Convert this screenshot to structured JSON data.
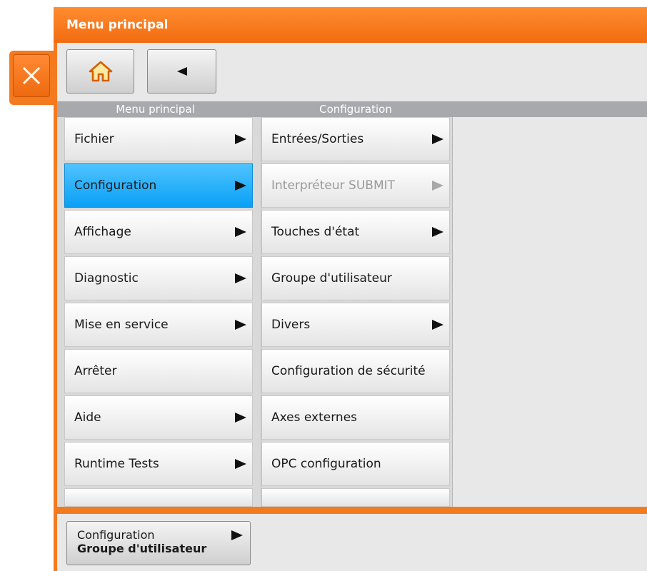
{
  "window": {
    "title": "Menu principal"
  },
  "toolbar": {
    "home_icon": "home-icon",
    "back_icon": "back-arrow-icon"
  },
  "columns": {
    "main_header": "Menu principal",
    "config_header": "Configuration"
  },
  "main_menu": [
    {
      "label": "Fichier",
      "has_submenu": true
    },
    {
      "label": "Configuration",
      "has_submenu": true,
      "active": true
    },
    {
      "label": "Affichage",
      "has_submenu": true
    },
    {
      "label": "Diagnostic",
      "has_submenu": true
    },
    {
      "label": "Mise en service",
      "has_submenu": true
    },
    {
      "label": "Arrêter",
      "has_submenu": false
    },
    {
      "label": "Aide",
      "has_submenu": true
    },
    {
      "label": "Runtime Tests",
      "has_submenu": true
    }
  ],
  "config_menu": [
    {
      "label": "Entrées/Sorties",
      "has_submenu": true
    },
    {
      "label": "Interpréteur SUBMIT",
      "has_submenu": true,
      "disabled": true
    },
    {
      "label": "Touches d'état",
      "has_submenu": true
    },
    {
      "label": "Groupe d'utilisateur",
      "has_submenu": false
    },
    {
      "label": "Divers",
      "has_submenu": true
    },
    {
      "label": "Configuration de sécurité",
      "has_submenu": false
    },
    {
      "label": "Axes externes",
      "has_submenu": false
    },
    {
      "label": "OPC configuration",
      "has_submenu": false
    }
  ],
  "breadcrumb": {
    "line1": "Configuration",
    "line2": "Groupe d'utilisateur"
  },
  "colors": {
    "accent": "#f47a1f",
    "active": "#1aa7f5"
  }
}
